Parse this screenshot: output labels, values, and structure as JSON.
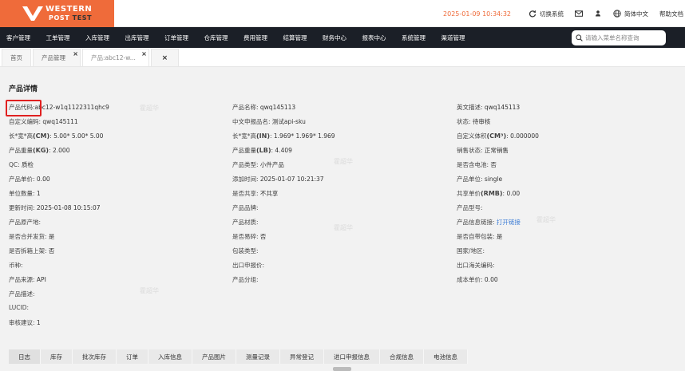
{
  "header": {
    "logo_line1": "WESTERN",
    "logo_line2_a": "POST ",
    "logo_line2_b": "TEST",
    "datetime": "2025-01-09 10:34:32",
    "switch_system": "切换系统",
    "language": "简体中文",
    "help": "帮助文档"
  },
  "nav": {
    "items": [
      "客户管理",
      "工单管理",
      "入库管理",
      "出库管理",
      "订单管理",
      "仓库管理",
      "费用管理",
      "结算管理",
      "财务中心",
      "报表中心",
      "系统管理",
      "渠道管理"
    ],
    "search_placeholder": "请输入菜单名称查询"
  },
  "tabs": {
    "home": "首页",
    "product_mgmt": "产品管理",
    "product_detail": "产品:abc12-w...",
    "close": "×"
  },
  "detail": {
    "title": "产品详情",
    "col1": [
      {
        "label": "产品代码:",
        "value": "abc12-w1q1122311qhc9"
      },
      {
        "label": "自定义编码:",
        "value": " qwq145111"
      },
      {
        "label_pre": "长*宽*高",
        "label_bold": "(CM)",
        "label_post": ":",
        "value": " 5.00* 5.00* 5.00"
      },
      {
        "label_pre": "产品重量",
        "label_bold": "(KG)",
        "label_post": ":",
        "value": " 2.000"
      },
      {
        "label": "QC:",
        "value": "  质检"
      },
      {
        "label": "产品单价:",
        "value": " 0.00"
      },
      {
        "label": "单位数量:",
        "value": " 1"
      },
      {
        "label": "更新时间:",
        "value": " 2025-01-08 10:15:07"
      },
      {
        "label": "产品原产地:",
        "value": ""
      },
      {
        "label": "是否合并发货:",
        "value": "  是"
      },
      {
        "label": "是否拆箱上架:",
        "value": "  否"
      },
      {
        "label": "币种:",
        "value": ""
      },
      {
        "label": "产品来源:",
        "value": "  API"
      },
      {
        "label": "产品描述:",
        "value": ""
      },
      {
        "label": "LUCID:",
        "value": ""
      },
      {
        "label": "审核建议:",
        "value": " 1"
      }
    ],
    "col2": [
      {
        "label": "产品名称:",
        "value": " qwq145113"
      },
      {
        "label": "中文申报品名:",
        "value": " 测试api-sku"
      },
      {
        "label_pre": "长*宽*高",
        "label_bold": "(IN)",
        "label_post": ":",
        "value": " 1.969* 1.969* 1.969"
      },
      {
        "label_pre": "产品重量",
        "label_bold": "(LB)",
        "label_post": ":",
        "value": " 4.409"
      },
      {
        "label": "产品类型:",
        "value": " 小件产品"
      },
      {
        "label": "添加时间:",
        "value": " 2025-01-07 10:21:37"
      },
      {
        "label": "是否共享:",
        "value": " 不共享"
      },
      {
        "label": "产品品牌:",
        "value": ""
      },
      {
        "label": "产品材质:",
        "value": ""
      },
      {
        "label": "是否易碎:",
        "value": "  否"
      },
      {
        "label": "包装类型:",
        "value": ""
      },
      {
        "label": "出口申报价:",
        "value": ""
      },
      {
        "label": "产品分组:",
        "value": ""
      }
    ],
    "col3": [
      {
        "label": "英文描述:",
        "value": " qwq145113"
      },
      {
        "label": "状态:",
        "value": " 待审核"
      },
      {
        "label_pre": "自定义体积",
        "label_bold": "(CM³)",
        "label_post": ":",
        "value": " 0.000000"
      },
      {
        "label": "销售状态:",
        "value": " 正常销售"
      },
      {
        "label": "是否含电池:",
        "value": " 否"
      },
      {
        "label": "产品单位:",
        "value": " single"
      },
      {
        "label_pre": "共享单价",
        "label_bold": "(RMB)",
        "label_post": ":",
        "value": " 0.00"
      },
      {
        "label": "产品型号:",
        "value": ""
      },
      {
        "label": "产品信息链接:",
        "value": "",
        "link": " 打开链接"
      },
      {
        "label": "是否自带包装:",
        "value": "  是"
      },
      {
        "label": "国家/地区:",
        "value": ""
      },
      {
        "label": "出口海关编码:",
        "value": ""
      },
      {
        "label": "成本单价:",
        "value": "   0.00"
      }
    ]
  },
  "bottom_tabs": [
    "日志",
    "库存",
    "批次库存",
    "订单",
    "入库信息",
    "产品图片",
    "测量记录",
    "异常登记",
    "进口申报信息",
    "合规信息",
    "电池信息"
  ],
  "watermark": "霍超华",
  "colors": {
    "brand": "#ef6b3a",
    "nav_bg": "#1b1f27",
    "link": "#3a7bd5",
    "highlight": "#e02020"
  }
}
